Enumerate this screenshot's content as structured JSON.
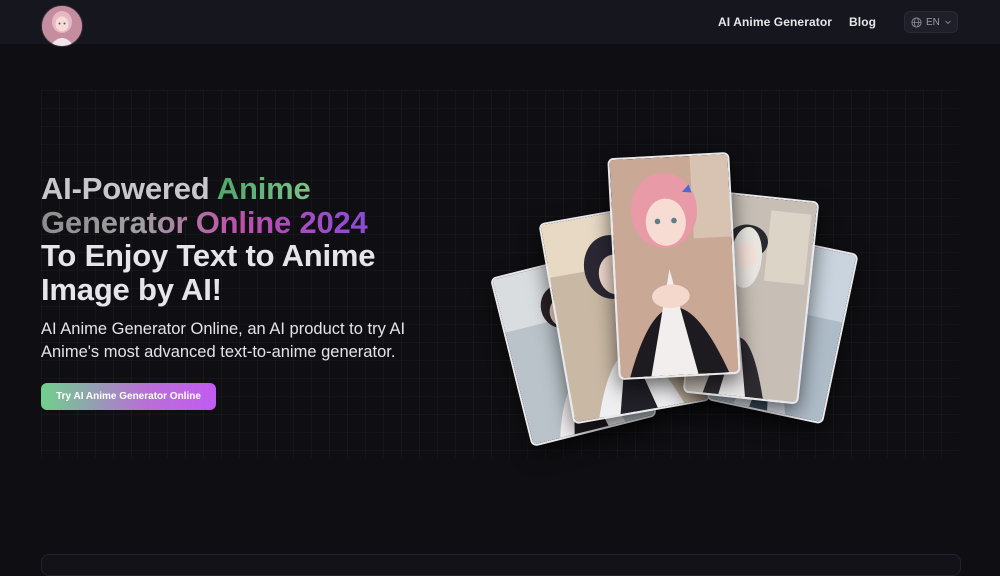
{
  "header": {
    "logo_alt": "logo",
    "nav": [
      {
        "label": "AI Anime Generator"
      },
      {
        "label": "Blog"
      }
    ],
    "language": {
      "value": "EN",
      "icon": "globe-icon"
    }
  },
  "hero": {
    "headline": {
      "part1": "AI-Powered ",
      "part2": "Anime",
      "part3": "Generator Online 2024",
      "part4": "To Enjoy Text to Anime Image by AI!"
    },
    "subtitle": "AI Anime Generator Online, an AI product to try AI Anime's most advanced text-to-anime generator.",
    "cta_label": "Try AI Anime Generator Online"
  },
  "colors": {
    "background": "#0f0f13",
    "header": "#16161f",
    "accent_green": "#4ea86a",
    "accent_purple": "#8a4bd6"
  }
}
